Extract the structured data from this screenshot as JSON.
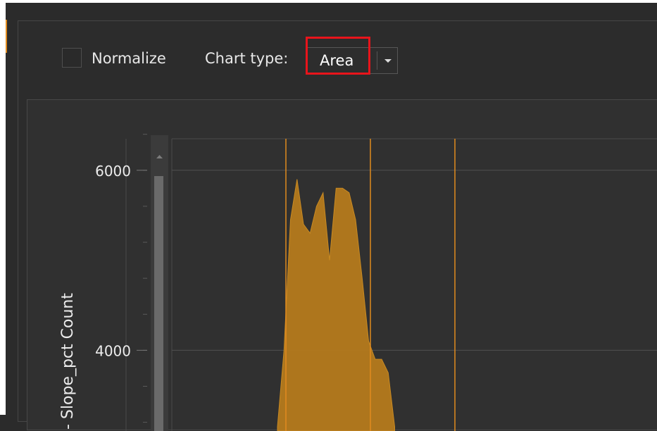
{
  "toolbar": {
    "normalize_label": "Normalize",
    "normalize_checked": false,
    "chart_type_label": "Chart type:",
    "chart_type_value": "Area"
  },
  "colors": {
    "accent": "#e08a1e",
    "area_fill": "#b57a1c",
    "highlight": "#e8141b",
    "background": "#2b2b2b"
  },
  "chart_data": {
    "type": "area",
    "ylabel": "- Slope_pct Count",
    "y_ticks": [
      6000,
      4000
    ],
    "ylim": [
      3150,
      6500
    ],
    "vertical_markers": [
      "orange-line-1",
      "orange-line-2",
      "orange-line-3"
    ],
    "series": [
      {
        "x": [
          1,
          2,
          3,
          4,
          5,
          6,
          7,
          8,
          9,
          10,
          11,
          12,
          13,
          14,
          15,
          16,
          17,
          18,
          19
        ],
        "values": [
          3150,
          4000,
          5450,
          5900,
          5400,
          5300,
          5600,
          5750,
          5000,
          5800,
          5800,
          5750,
          5450,
          4800,
          4100,
          3900,
          3900,
          3750,
          3150
        ]
      }
    ]
  }
}
